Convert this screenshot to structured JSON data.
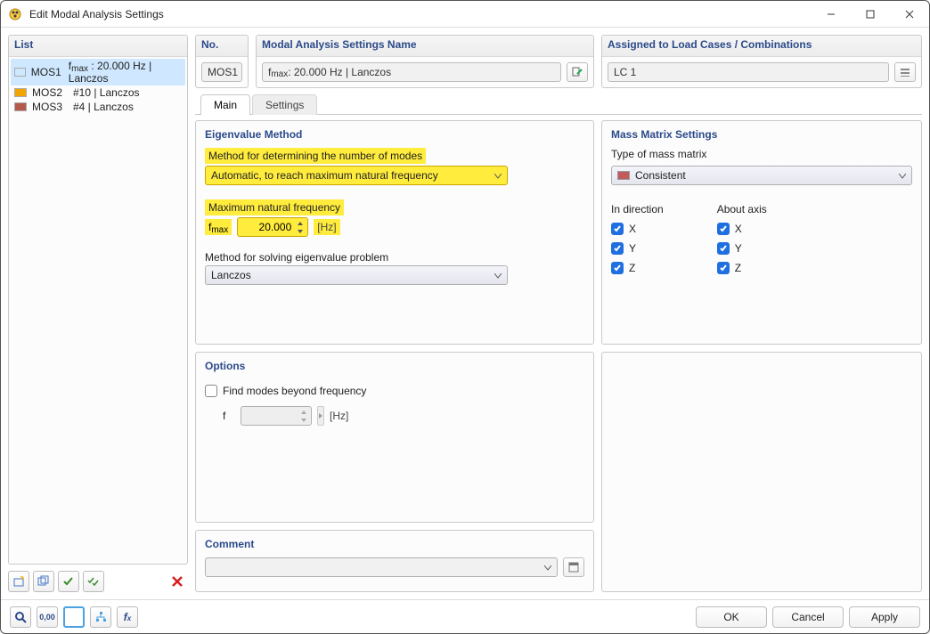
{
  "window": {
    "title": "Edit Modal Analysis Settings"
  },
  "list": {
    "header": "List",
    "items": [
      {
        "code": "MOS1",
        "desc": "fmax : 20.000 Hz | Lanczos",
        "swatch": "#cfe8ff",
        "selected": true
      },
      {
        "code": "MOS2",
        "desc": "#10 | Lanczos",
        "swatch": "#f2a500",
        "selected": false
      },
      {
        "code": "MOS3",
        "desc": "#4 | Lanczos",
        "swatch": "#b35a4a",
        "selected": false
      }
    ]
  },
  "header": {
    "no_label": "No.",
    "no_value": "MOS1",
    "name_label": "Modal Analysis Settings Name",
    "name_value": "fmax : 20.000 Hz | Lanczos",
    "lc_label": "Assigned to Load Cases / Combinations",
    "lc_value": "LC 1"
  },
  "tabs": {
    "main": "Main",
    "settings": "Settings"
  },
  "eigen": {
    "title": "Eigenvalue Method",
    "mode_label": "Method for determining the number of modes",
    "mode_value": "Automatic, to reach maximum natural frequency",
    "fmax_label": "Maximum natural frequency",
    "fmax_sym": "fmax",
    "fmax_value": "20.000",
    "fmax_unit": "[Hz]",
    "solve_label": "Method for solving eigenvalue problem",
    "solve_value": "Lanczos"
  },
  "mass": {
    "title": "Mass Matrix Settings",
    "type_label": "Type of mass matrix",
    "type_value": "Consistent",
    "dir_label": "In direction",
    "axis_label": "About axis",
    "x": "X",
    "y": "Y",
    "z": "Z"
  },
  "options": {
    "title": "Options",
    "find_label": "Find modes beyond frequency",
    "f_sym": "f",
    "f_unit": "[Hz]"
  },
  "comment": {
    "title": "Comment"
  },
  "buttons": {
    "ok": "OK",
    "cancel": "Cancel",
    "apply": "Apply"
  }
}
